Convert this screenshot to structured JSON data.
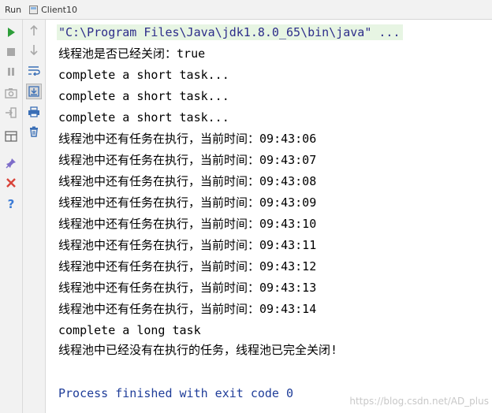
{
  "titlebar": {
    "run_label": "Run",
    "config_label": "Client10"
  },
  "toolbar_left": [
    {
      "name": "rerun-icon",
      "color": "#2e9e3a"
    },
    {
      "name": "stop-icon",
      "color": "#9a9a9a"
    },
    {
      "name": "pause-icon",
      "color": "#9a9a9a"
    },
    {
      "name": "camera-icon",
      "color": "#9a9a9a"
    },
    {
      "name": "exit-icon",
      "color": "#9a9a9a"
    },
    {
      "name": "layout-icon",
      "color": "#6a6a6a"
    },
    {
      "name": "pin-icon",
      "color": "#6a5acd"
    },
    {
      "name": "close-icon",
      "color": "#d9443a"
    },
    {
      "name": "help-icon",
      "color": "#3b7bd6"
    }
  ],
  "toolbar_right": [
    {
      "name": "up-arrow-icon",
      "color": "#9a9a9a"
    },
    {
      "name": "down-arrow-icon",
      "color": "#9a9a9a"
    },
    {
      "name": "soft-wrap-icon",
      "color": "#3b6fb6"
    },
    {
      "name": "scroll-to-end-icon",
      "color": "#3b6fb6"
    },
    {
      "name": "print-icon",
      "color": "#3b6fb6"
    },
    {
      "name": "trash-icon",
      "color": "#3b6fb6"
    }
  ],
  "console": {
    "command_line": "\"C:\\Program Files\\Java\\jdk1.8.0_65\\bin\\java\" ...",
    "lines": [
      "线程池是否已经关闭：true",
      "complete a short task...",
      "complete a short task...",
      "complete a short task...",
      "线程池中还有任务在执行，当前时间：09:43:06",
      "线程池中还有任务在执行，当前时间：09:43:07",
      "线程池中还有任务在执行，当前时间：09:43:08",
      "线程池中还有任务在执行，当前时间：09:43:09",
      "线程池中还有任务在执行，当前时间：09:43:10",
      "线程池中还有任务在执行，当前时间：09:43:11",
      "线程池中还有任务在执行，当前时间：09:43:12",
      "线程池中还有任务在执行，当前时间：09:43:13",
      "线程池中还有任务在执行，当前时间：09:43:14",
      "complete a long task",
      "线程池中已经没有在执行的任务，线程池已完全关闭!"
    ],
    "finished_line": "Process finished with exit code 0"
  },
  "watermark": "https://blog.csdn.net/AD_plus"
}
